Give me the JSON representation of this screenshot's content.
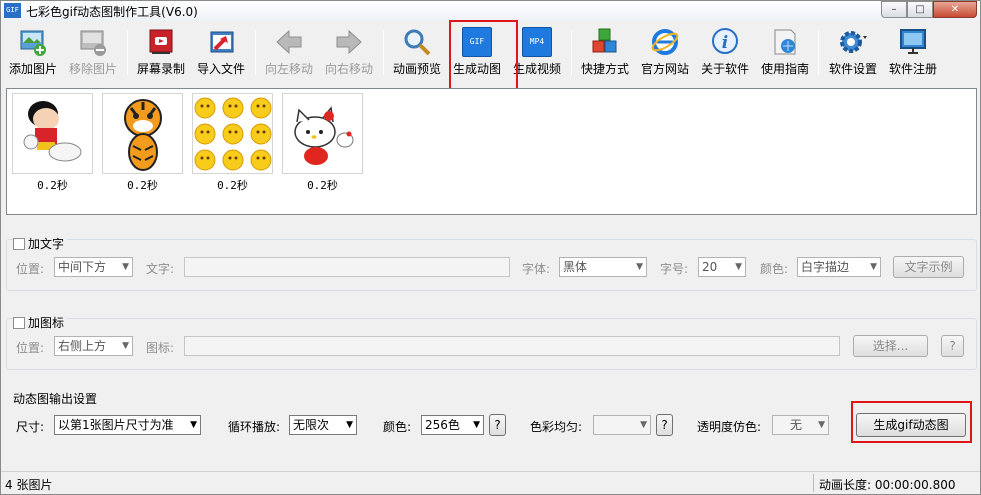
{
  "window": {
    "app_icon_text": "GIF",
    "title": "七彩色gif动态图制作工具(V6.0)",
    "min_icon": "minimize-icon",
    "max_icon": "maximize-icon",
    "close_icon": "close-icon"
  },
  "toolbar": {
    "items": [
      {
        "label": "添加图片",
        "icon": "add-image-icon",
        "enabled": true
      },
      {
        "label": "移除图片",
        "icon": "remove-image-icon",
        "enabled": false
      },
      {
        "label": "屏幕录制",
        "icon": "screen-record-icon",
        "enabled": true
      },
      {
        "label": "导入文件",
        "icon": "import-file-icon",
        "enabled": true
      },
      {
        "label": "向左移动",
        "icon": "arrow-left-icon",
        "enabled": false
      },
      {
        "label": "向右移动",
        "icon": "arrow-right-icon",
        "enabled": false
      },
      {
        "label": "动画预览",
        "icon": "magnifier-icon",
        "enabled": true
      },
      {
        "label": "生成动图",
        "icon": "gif-icon",
        "icon_text": "GIF",
        "enabled": true
      },
      {
        "label": "生成视频",
        "icon": "mp4-icon",
        "icon_text": "MP4",
        "enabled": true
      },
      {
        "label": "快捷方式",
        "icon": "cubes-icon",
        "enabled": true
      },
      {
        "label": "官方网站",
        "icon": "ie-icon",
        "enabled": true
      },
      {
        "label": "关于软件",
        "icon": "info-icon",
        "enabled": true
      },
      {
        "label": "使用指南",
        "icon": "guide-icon",
        "enabled": true
      },
      {
        "label": "软件设置",
        "icon": "gear-icon",
        "enabled": true
      },
      {
        "label": "软件注册",
        "icon": "monitor-icon",
        "enabled": true
      }
    ]
  },
  "images": [
    {
      "caption": "0.2秒",
      "subject": "crayon-shin-chan-image"
    },
    {
      "caption": "0.2秒",
      "subject": "tiger-cartoon-image"
    },
    {
      "caption": "0.2秒",
      "subject": "emoji-faces-image"
    },
    {
      "caption": "0.2秒",
      "subject": "hello-kitty-image"
    }
  ],
  "text_panel": {
    "checkbox_label": "加文字",
    "position_label": "位置:",
    "position_value": "中间下方",
    "text_label": "文字:",
    "font_label": "字体:",
    "font_value": "黑体",
    "size_label": "字号:",
    "size_value": "20",
    "color_label": "颜色:",
    "color_value": "白字描边",
    "sample_button": "文字示例"
  },
  "icon_panel": {
    "checkbox_label": "加图标",
    "position_label": "位置:",
    "position_value": "右侧上方",
    "icon_label": "图标:",
    "choose_button": "选择...",
    "help_button": "?"
  },
  "output": {
    "title": "动态图输出设置",
    "size_label": "尺寸:",
    "size_value": "以第1张图片尺寸为准",
    "loop_label": "循环播放:",
    "loop_value": "无限次",
    "color_label": "颜色:",
    "color_value": "256色",
    "color_help": "?",
    "balance_label": "色彩均匀:",
    "balance_value": "",
    "balance_help": "?",
    "transparency_label": "透明度仿色:",
    "transparency_value": "无",
    "generate_button": "生成gif动态图"
  },
  "status": {
    "count": "4 张图片",
    "duration": "动画长度: 00:00:00.800"
  },
  "colors": {
    "highlight_red": "#e0161b",
    "accent_blue": "#2a6fc7"
  }
}
